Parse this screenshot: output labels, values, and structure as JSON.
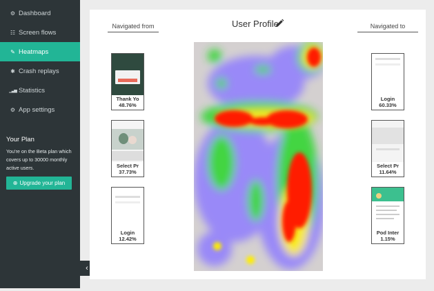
{
  "sidebar": {
    "items": [
      {
        "icon": "dashboard-icon",
        "glyph": "⚙",
        "label": "Dashboard",
        "active": false
      },
      {
        "icon": "grid-icon",
        "glyph": "☷",
        "label": "Screen flows",
        "active": false
      },
      {
        "icon": "flame-icon",
        "glyph": "✎",
        "label": "Heatmaps",
        "active": true
      },
      {
        "icon": "bug-icon",
        "glyph": "✱",
        "label": "Crash replays",
        "active": false
      },
      {
        "icon": "bar-chart-icon",
        "glyph": "▁▃▅",
        "label": "Statistics",
        "active": false
      },
      {
        "icon": "gears-icon",
        "glyph": "⚙",
        "label": "App settings",
        "active": false
      }
    ],
    "plan": {
      "title": "Your Plan",
      "description": "You're on the Beta plan which covers up to 30000 monthly active users.",
      "upgrade_label": "Upgrade your plan",
      "upgrade_glyph": "⊕"
    },
    "collapse_glyph": "‹"
  },
  "main": {
    "screen_title": "User Profile",
    "navigated_from": {
      "heading": "Navigated from",
      "items": [
        {
          "name": "Thank Yo",
          "percent": "48.76%"
        },
        {
          "name": "Select Pr",
          "percent": "37.73%"
        },
        {
          "name": "Login",
          "percent": "12.42%"
        }
      ]
    },
    "navigated_to": {
      "heading": "Navigated to",
      "items": [
        {
          "name": "Login",
          "percent": "60.33%"
        },
        {
          "name": "Select Pr",
          "percent": "11.64%"
        },
        {
          "name": "Pod Inter",
          "percent": "1.15%"
        }
      ]
    }
  },
  "colors": {
    "sidebar_bg": "#2d3538",
    "accent": "#22b596",
    "heat_hot": "#ff1a00",
    "heat_warm": "#ffee00",
    "heat_mid": "#2bd62b",
    "heat_cool": "#7a66ff"
  }
}
